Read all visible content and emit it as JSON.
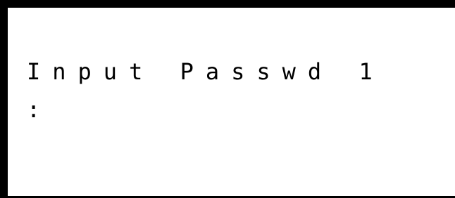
{
  "prompt": {
    "label": "Input Passwd 1",
    "value": ":"
  },
  "colors": {
    "foreground": "#000000",
    "background": "#ffffff"
  }
}
